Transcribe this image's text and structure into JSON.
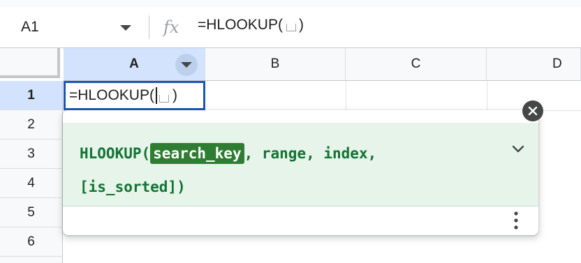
{
  "name_box": {
    "value": "A1"
  },
  "formula_bar": {
    "fx_label": "fx",
    "formula_prefix": "=HLOOKUP(",
    "formula_suffix": ")"
  },
  "grid": {
    "columns": [
      {
        "label": "A",
        "selected": true
      },
      {
        "label": "B",
        "selected": false
      },
      {
        "label": "C",
        "selected": false
      },
      {
        "label": "D",
        "selected": false
      }
    ],
    "rows": [
      "1",
      "2",
      "3",
      "4",
      "5",
      "6"
    ]
  },
  "active_cell": {
    "prefix": "=HLOOKUP(",
    "suffix": ")"
  },
  "formula_help": {
    "function_name": "HLOOKUP(",
    "active_arg": "search_key",
    "rest_line1": ", range, index,",
    "line2": "[is_sorted])"
  },
  "icons": {
    "name_box_dropdown": "chevron-down-icon",
    "column_menu": "dropdown-arrow-icon",
    "close": "close-icon",
    "expand": "chevron-down-icon",
    "more": "more-vertical-icon"
  },
  "colors": {
    "selection_blue": "#1a56b6",
    "selected_header": "#d3e3fd",
    "help_bg": "#e6f4ea",
    "help_text": "#137333",
    "arg_highlight": "#2e7d32"
  }
}
